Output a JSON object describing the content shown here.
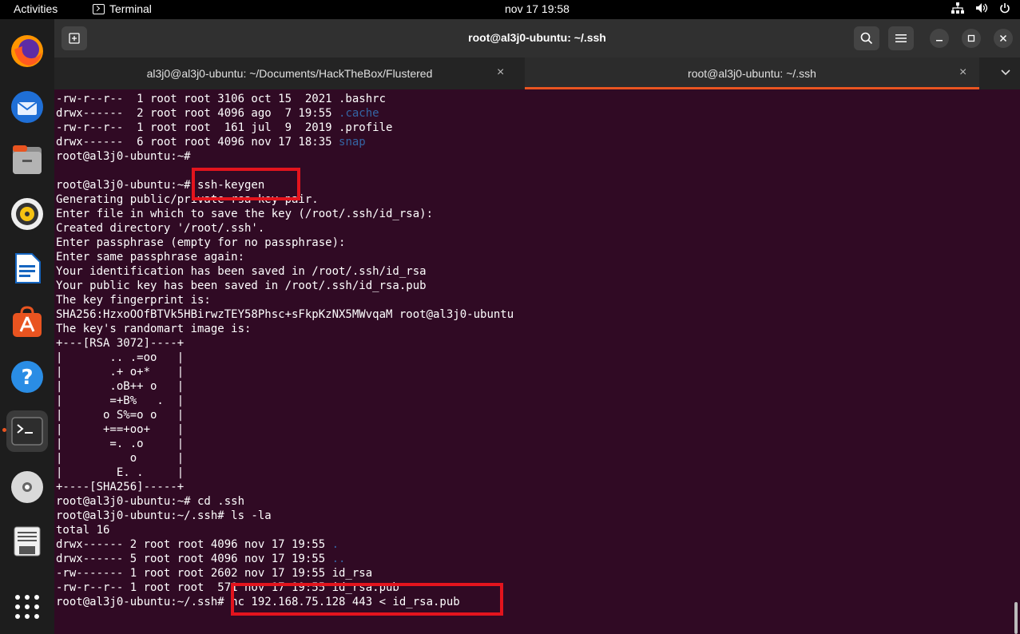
{
  "topbar": {
    "activities": "Activities",
    "app_name": "Terminal",
    "clock": "nov 17  19:58"
  },
  "window": {
    "title": "root@al3j0-ubuntu: ~/.ssh"
  },
  "tabs": [
    {
      "label": "al3j0@al3j0-ubuntu: ~/Documents/HackTheBox/Flustered",
      "close": "×"
    },
    {
      "label": "root@al3j0-ubuntu: ~/.ssh",
      "close": "×"
    }
  ],
  "terminal": {
    "lines": [
      "-rw-r--r--  1 root root 3106 oct 15  2021 .bashrc",
      "drwx------  2 root root 4096 ago  7 19:55 ",
      "-rw-r--r--  1 root root  161 jul  9  2019 .profile",
      "drwx------  6 root root 4096 nov 17 18:35 ",
      "root@al3j0-ubuntu:~#",
      "",
      "root@al3j0-ubuntu:~# ssh-keygen",
      "Generating public/private rsa key pair.",
      "Enter file in which to save the key (/root/.ssh/id_rsa):",
      "Created directory '/root/.ssh'.",
      "Enter passphrase (empty for no passphrase):",
      "Enter same passphrase again:",
      "Your identification has been saved in /root/.ssh/id_rsa",
      "Your public key has been saved in /root/.ssh/id_rsa.pub",
      "The key fingerprint is:",
      "SHA256:HzxoOOfBTVk5HBirwzTEY58Phsc+sFkpKzNX5MWvqaM root@al3j0-ubuntu",
      "The key's randomart image is:",
      "+---[RSA 3072]----+",
      "|       .. .=oo   |",
      "|       .+ o+*    |",
      "|       .oB++ o   |",
      "|       =+B%   .  |",
      "|      o S%=o o   |",
      "|      +==+oo+    |",
      "|       =. .o     |",
      "|          o      |",
      "|        E. .     |",
      "+----[SHA256]-----+",
      "root@al3j0-ubuntu:~# cd .ssh",
      "root@al3j0-ubuntu:~/.ssh# ls -la",
      "total 16",
      "drwx------ 2 root root 4096 nov 17 19:55 ",
      "drwx------ 5 root root 4096 nov 17 19:55 ",
      "-rw------- 1 root root 2602 nov 17 19:55 id_rsa",
      "-rw-r--r-- 1 root root  571 nov 17 19:55 id_rsa.pub",
      "root@al3j0-ubuntu:~/.ssh# nc 192.168.75.128 443 < id_rsa.pub"
    ],
    "dir_names": {
      "1": ".cache",
      "3": "snap",
      "31": ".",
      "32": ".."
    }
  },
  "colors": {
    "terminal_bg": "#300a24",
    "dir_color": "#3465a4",
    "accent": "#e95420",
    "highlight": "#e3141d"
  },
  "dock": {
    "icons": [
      "firefox-icon",
      "thunderbird-icon",
      "files-icon",
      "rhythmbox-icon",
      "writer-icon",
      "software-icon",
      "help-icon",
      "terminal-icon",
      "disc-icon",
      "document-icon",
      "apps-grid-icon"
    ]
  }
}
